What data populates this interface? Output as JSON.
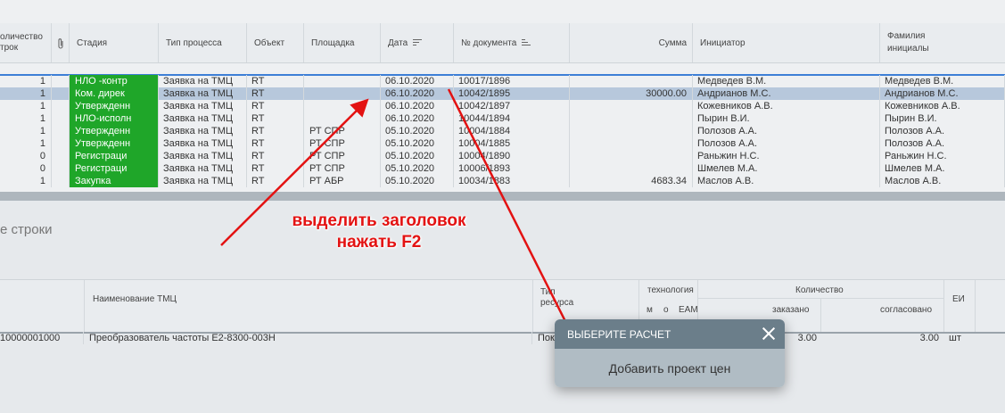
{
  "top_grid": {
    "headers": {
      "count": "оличество\nтрок",
      "stage": "Стадия",
      "process_type": "Тип процесса",
      "object": "Объект",
      "site": "Площадка",
      "date": "Дата",
      "doc_no": "№ документа",
      "sum": "Сумма",
      "initiator": "Инициатор",
      "surname": "Фамилия\nинициалы"
    },
    "rows": [
      {
        "count": "1",
        "stage": "НЛО -контр",
        "ptype": "Заявка на ТМЦ",
        "obj": "RT",
        "site": "",
        "date": "06.10.2020",
        "doc": "10017/1896",
        "sum": "",
        "init": "Медведев В.М.",
        "sur": "Медведев В.М."
      },
      {
        "count": "1",
        "stage": "Ком. дирек",
        "ptype": "Заявка на ТМЦ",
        "obj": "RT",
        "site": "",
        "date": "06.10.2020",
        "doc": "10042/1895",
        "sum": "30000.00",
        "init": "Андрианов М.С.",
        "sur": "Андрианов М.С.",
        "selected": true
      },
      {
        "count": "1",
        "stage": "Утвержденн",
        "ptype": "Заявка на ТМЦ",
        "obj": "RT",
        "site": "",
        "date": "06.10.2020",
        "doc": "10042/1897",
        "sum": "",
        "init": "Кожевников А.В.",
        "sur": "Кожевников А.В."
      },
      {
        "count": "1",
        "stage": "НЛО-исполн",
        "ptype": "Заявка на ТМЦ",
        "obj": "RT",
        "site": "",
        "date": "06.10.2020",
        "doc": "10044/1894",
        "sum": "",
        "init": "Пырин В.И.",
        "sur": "Пырин В.И."
      },
      {
        "count": "1",
        "stage": "Утвержденн",
        "ptype": "Заявка на ТМЦ",
        "obj": "RT",
        "site": "РТ СПР",
        "date": "05.10.2020",
        "doc": "10004/1884",
        "sum": "",
        "init": "Полозов А.А.",
        "sur": "Полозов А.А."
      },
      {
        "count": "1",
        "stage": "Утвержденн",
        "ptype": "Заявка на ТМЦ",
        "obj": "RT",
        "site": "РТ СПР",
        "date": "05.10.2020",
        "doc": "10004/1885",
        "sum": "",
        "init": "Полозов А.А.",
        "sur": "Полозов А.А."
      },
      {
        "count": "0",
        "stage": "Регистраци",
        "ptype": "Заявка на ТМЦ",
        "obj": "RT",
        "site": "РТ СПР",
        "date": "05.10.2020",
        "doc": "10004/1890",
        "sum": "",
        "init": "Раньжин Н.С.",
        "sur": "Раньжин Н.С."
      },
      {
        "count": "0",
        "stage": "Регистраци",
        "ptype": "Заявка на ТМЦ",
        "obj": "RT",
        "site": "РТ СПР",
        "date": "05.10.2020",
        "doc": "10006/1893",
        "sum": "",
        "init": "Шмелев М.А.",
        "sur": "Шмелев М.А."
      },
      {
        "count": "1",
        "stage": "Закупка",
        "ptype": "Заявка на ТМЦ",
        "obj": "RT",
        "site": "РТ АБР",
        "date": "05.10.2020",
        "doc": "10034/1883",
        "sum": "4683.34",
        "init": "Маслов А.В.",
        "sur": "Маслов А.В."
      }
    ]
  },
  "section_title": "е строки",
  "bottom_grid": {
    "headers": {
      "name": "Наименование ТМЦ",
      "resource_type": "Тип\nресурса",
      "technology": "технология",
      "tech_m": "м",
      "tech_o": "о",
      "tech_eam": "EAM",
      "quantity": "Количество",
      "ordered": "заказано",
      "agreed": "согласовано",
      "unit": "ЕИ"
    },
    "row": {
      "code": "10000001000",
      "name": "Преобразователь частоты E2-8300-003H",
      "resource": "Пок",
      "ordered": "3.00",
      "agreed": "3.00",
      "unit": "шт"
    }
  },
  "dialog": {
    "title": "ВЫБЕРИТЕ РАСЧЕТ",
    "option": "Добавить проект цен",
    "close_icon": "close-icon"
  },
  "annotation": {
    "line1": "выделить заголовок",
    "line2": "нажать F2",
    "color": "#e31212"
  }
}
